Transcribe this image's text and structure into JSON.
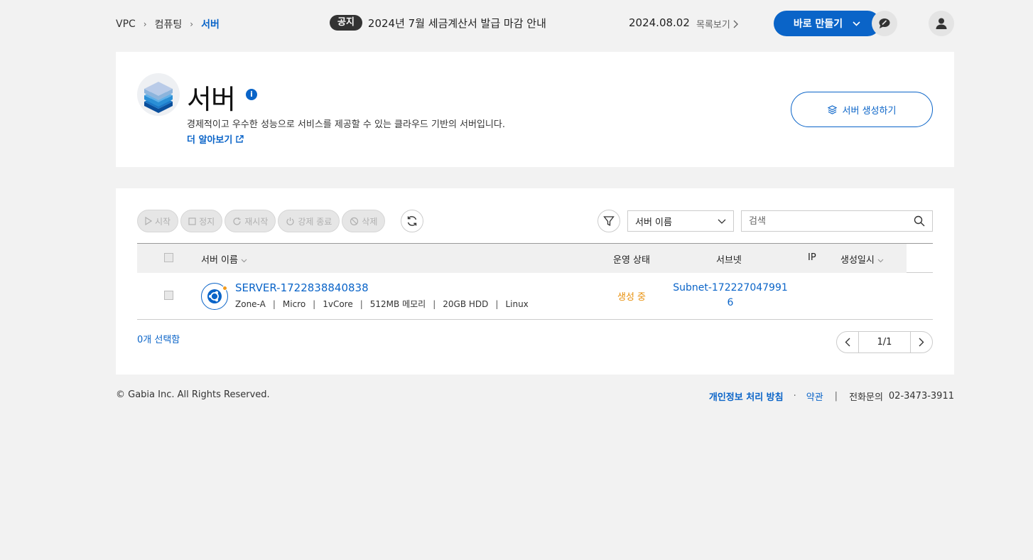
{
  "breadcrumb": {
    "items": [
      "VPC",
      "컴퓨팅"
    ],
    "current": "서버"
  },
  "notice": {
    "badge": "공지",
    "text": "2024년 7월 세금계산서 발급 마감 안내",
    "date": "2024.08.02",
    "more": "목록보기"
  },
  "header_actions": {
    "quick_create": "바로 만들기"
  },
  "hero": {
    "title": "서버",
    "description": "경제적이고 우수한 성능으로 서비스를 제공할 수 있는 클라우드 기반의 서버입니다.",
    "learn_more": "더 알아보기",
    "create_button": "서버 생성하기"
  },
  "toolbar": {
    "start": "시작",
    "stop": "정지",
    "restart": "재시작",
    "force_stop": "강제 종료",
    "delete": "삭제"
  },
  "filter": {
    "selected": "서버 이름",
    "search_placeholder": "검색"
  },
  "table": {
    "columns": {
      "name": "서버 이름",
      "status": "운영 상태",
      "subnet": "서브넷",
      "ip": "IP",
      "created": "생성일시"
    },
    "rows": [
      {
        "name": "SERVER-1722838840838",
        "zone": "Zone-A",
        "type": "Micro",
        "cpu": "1vCore",
        "memory": "512MB 메모리",
        "disk": "20GB HDD",
        "os": "Linux",
        "status": "생성 중",
        "subnet": "Subnet-1722270479916",
        "ip": "",
        "created": ""
      }
    ]
  },
  "selection": {
    "count_text": "0개 선택함"
  },
  "pagination": {
    "text": "1/1"
  },
  "footer": {
    "copyright": "© Gabia Inc. All Rights Reserved.",
    "privacy": "개인정보 처리 방침",
    "terms": "약관",
    "contact_label": "전화문의",
    "contact_number": "02-3473-3911"
  },
  "colors": {
    "accent": "#0a64c8",
    "status_creating": "#e8900c",
    "background": "#f2f2f2"
  }
}
